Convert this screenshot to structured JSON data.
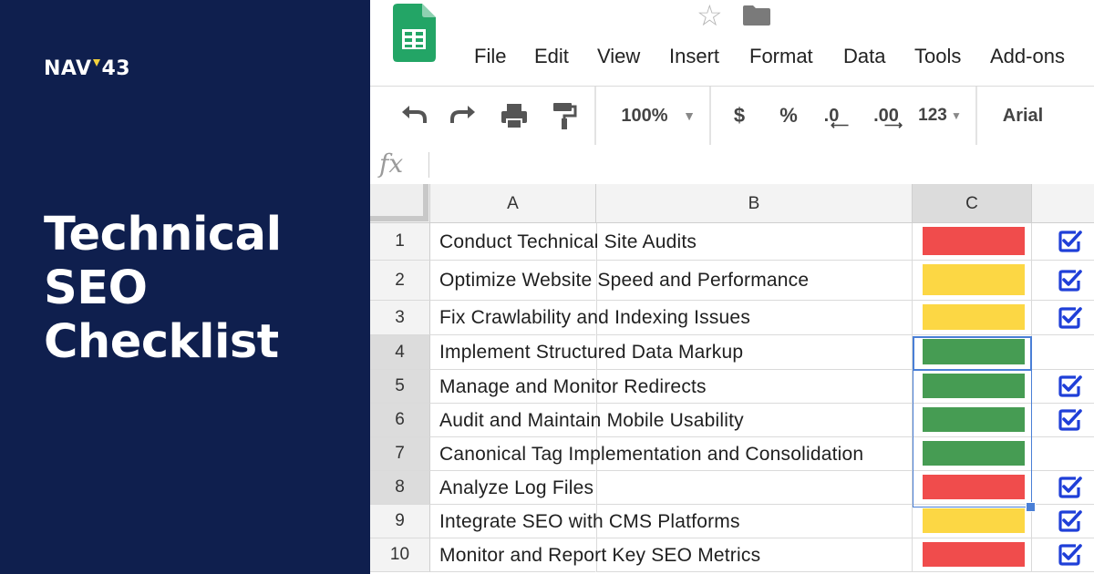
{
  "brand": {
    "logo_text_left": "NAV",
    "logo_text_right": "43",
    "logo_accent_color": "#f3d23c",
    "panel_color": "#0f1f4e"
  },
  "headline": {
    "line1": "Technical",
    "line2": "SEO",
    "line3": "Checklist"
  },
  "app": {
    "icon": "google-sheets-icon",
    "menu": [
      "File",
      "Edit",
      "View",
      "Insert",
      "Format",
      "Data",
      "Tools",
      "Add-ons"
    ],
    "toolbar": {
      "zoom": "100%",
      "currency": "$",
      "percent": "%",
      "decrease_decimals": ".0",
      "increase_decimals": ".00",
      "more_formats": "123",
      "font": "Arial"
    },
    "formula_label": "fx",
    "columns": [
      "A",
      "B",
      "C"
    ],
    "rows": [
      {
        "num": "1",
        "task": "Conduct Technical Site Audits",
        "status": "red",
        "checked": true
      },
      {
        "num": "2",
        "task": "Optimize Website Speed and Performance",
        "status": "yellow",
        "checked": true
      },
      {
        "num": "3",
        "task": "Fix Crawlability and Indexing Issues",
        "status": "yellow",
        "checked": true
      },
      {
        "num": "4",
        "task": "Implement Structured Data Markup",
        "status": "green",
        "checked": false
      },
      {
        "num": "5",
        "task": "Manage and Monitor Redirects",
        "status": "green",
        "checked": true
      },
      {
        "num": "6",
        "task": "Audit and Maintain Mobile Usability",
        "status": "green",
        "checked": true
      },
      {
        "num": "7",
        "task": "Canonical Tag Implementation and Consolidation",
        "status": "green",
        "checked": false
      },
      {
        "num": "8",
        "task": "Analyze Log Files",
        "status": "red",
        "checked": true
      },
      {
        "num": "9",
        "task": "Integrate SEO with CMS Platforms",
        "status": "yellow",
        "checked": true
      },
      {
        "num": "10",
        "task": "Monitor and Report Key SEO Metrics",
        "status": "red",
        "checked": true
      }
    ],
    "status_colors": {
      "red": "#f04c4c",
      "yellow": "#fcd744",
      "green": "#469c53"
    },
    "check_color": "#1f3fd8",
    "selection_color": "#4a7fd6"
  }
}
